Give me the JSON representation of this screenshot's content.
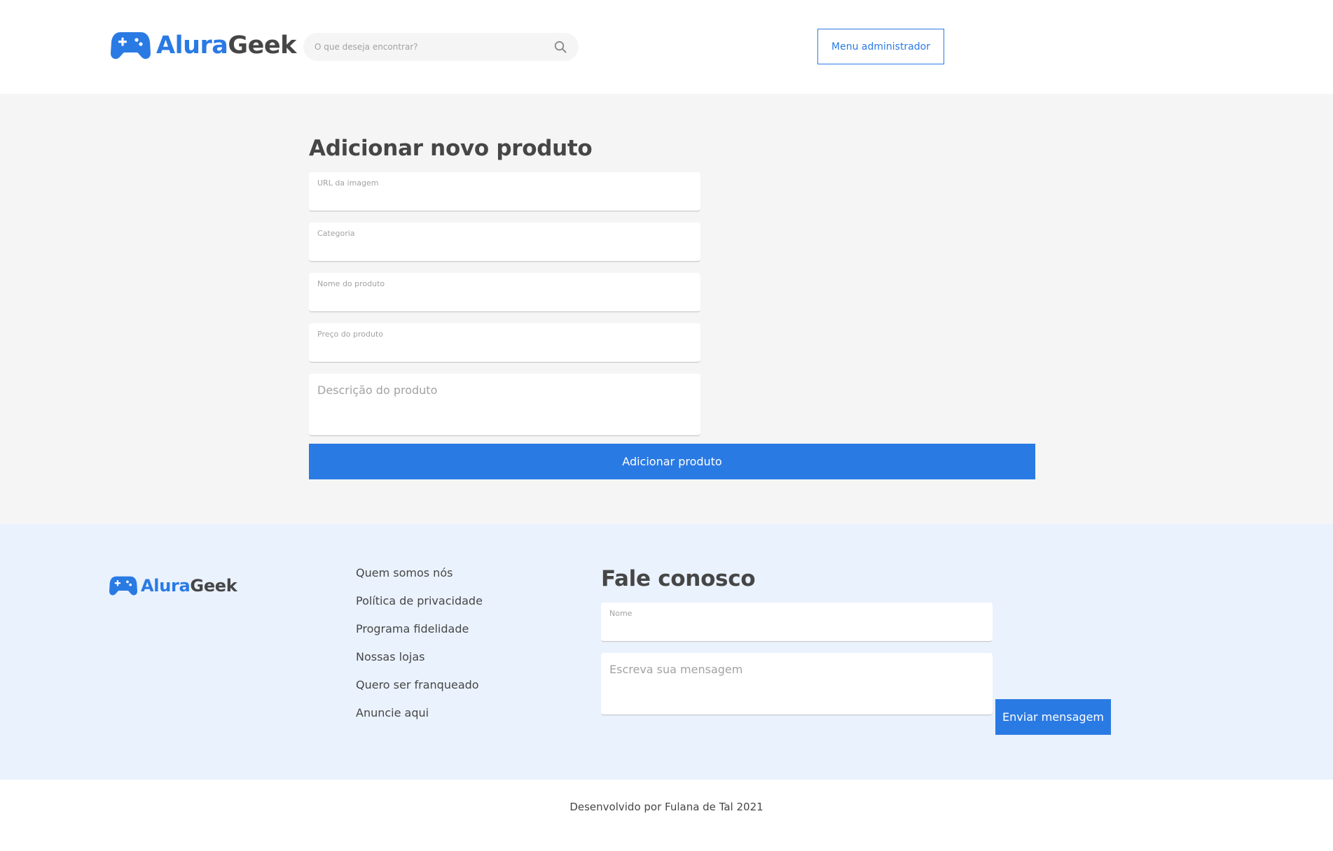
{
  "brand": {
    "name_part1": "Alura",
    "name_part2": "Geek",
    "accent_color": "#2a7ae4",
    "logo_icon": "gamepad-icon"
  },
  "header": {
    "search_placeholder": "O que deseja encontrar?",
    "search_icon": "search-icon",
    "admin_button_label": "Menu administrador"
  },
  "product_form": {
    "title": "Adicionar novo produto",
    "fields": {
      "image_url_label": "URL da imagem",
      "category_label": "Categoria",
      "name_label": "Nome do produto",
      "price_label": "Preço do produto",
      "description_placeholder": "Descrição do produto"
    },
    "submit_label": "Adicionar produto"
  },
  "footer": {
    "links": [
      "Quem somos nós",
      "Política de privacidade",
      "Programa fidelidade",
      "Nossas lojas",
      "Quero ser franqueado",
      "Anuncie aqui"
    ],
    "contact": {
      "title": "Fale conosco",
      "name_label": "Nome",
      "message_placeholder": "Escreva sua mensagem",
      "send_label": "Enviar mensagem"
    },
    "credits": "Desenvolvido por Fulana de Tal 2021"
  }
}
